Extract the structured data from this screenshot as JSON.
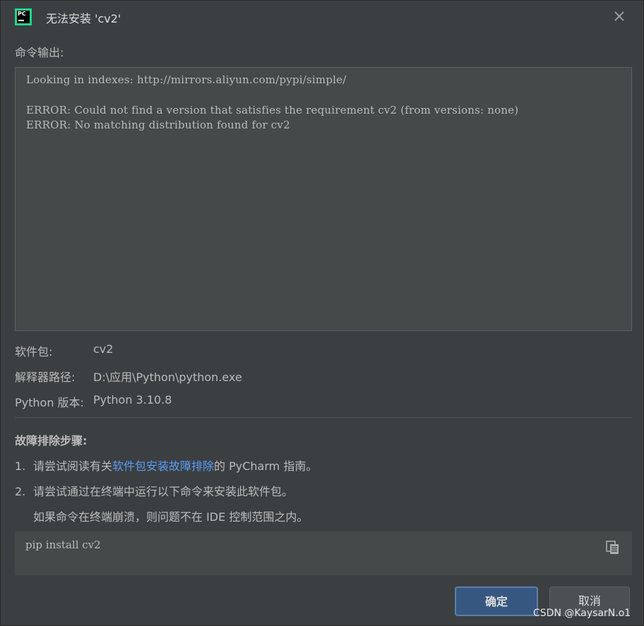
{
  "window": {
    "title": "无法安装 'cv2'",
    "app_icon_text": "PC"
  },
  "output": {
    "label": "命令输出:",
    "lines": [
      "Looking in indexes: http://mirrors.aliyun.com/pypi/simple/",
      "",
      "ERROR: Could not find a version that satisfies the requirement cv2 (from versions: none)",
      "ERROR: No matching distribution found for cv2"
    ]
  },
  "info": {
    "package_label": "软件包:",
    "package_value": "cv2",
    "interpreter_label": "解释器路径:",
    "interpreter_value": "D:\\应用\\Python\\python.exe",
    "python_version_label": "Python 版本:",
    "python_version_value": "Python 3.10.8"
  },
  "troubleshoot": {
    "title": "故障排除步骤:",
    "step1_num": "1.",
    "step1_prefix": "请尝试阅读有关",
    "step1_link": "软件包安装故障排除",
    "step1_suffix": "的 PyCharm 指南。",
    "step2_num": "2.",
    "step2_text": "请尝试通过在终端中运行以下命令来安装此软件包。",
    "step2_note": "如果命令在终端崩溃，则问题不在 IDE 控制范围之内。"
  },
  "command": {
    "text": "pip install cv2",
    "copy_icon": "copy-icon"
  },
  "buttons": {
    "ok_label": "确定",
    "cancel_label": "取消"
  },
  "watermark": "CSDN @KaysarN.o1",
  "colors": {
    "background": "#3c3f41",
    "panel": "#45494a",
    "link": "#589df6",
    "primary_button": "#365880"
  }
}
